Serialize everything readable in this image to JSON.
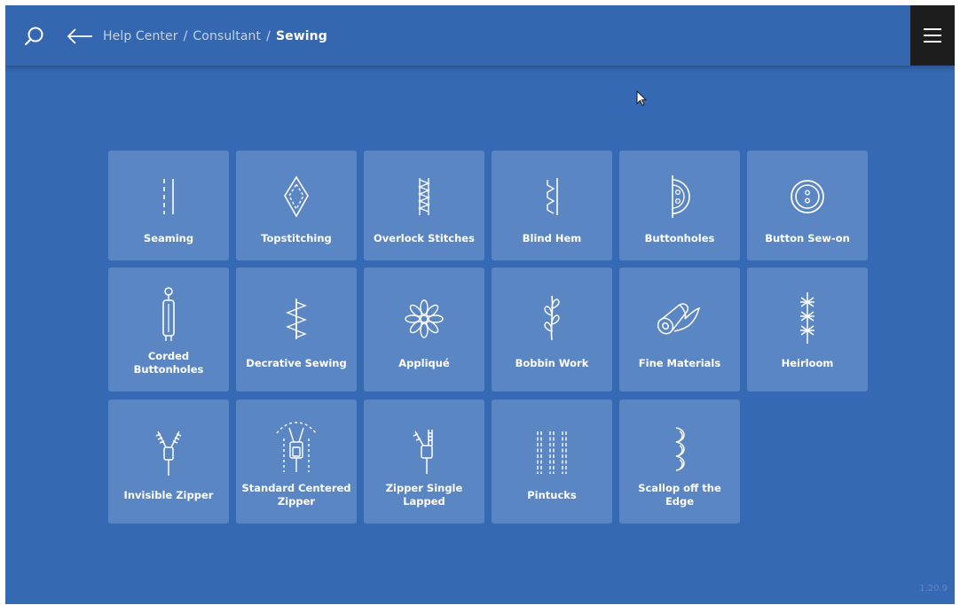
{
  "header": {
    "breadcrumb": {
      "help_center": "Help Center",
      "consultant": "Consultant",
      "current": "Sewing",
      "separator": "/"
    },
    "icons": {
      "search": "search-icon",
      "back": "arrow-left-icon",
      "menu": "hamburger-menu-icon"
    }
  },
  "tiles": [
    {
      "label": "Seaming",
      "icon": "seaming-icon"
    },
    {
      "label": "Topstitching",
      "icon": "topstitching-icon"
    },
    {
      "label": "Overlock Stitches",
      "icon": "overlock-stitch-icon"
    },
    {
      "label": "Blind Hem",
      "icon": "blind-hem-icon"
    },
    {
      "label": "Buttonholes",
      "icon": "buttonhole-icon"
    },
    {
      "label": "Button Sew-on",
      "icon": "button-icon"
    },
    {
      "label": "Corded Buttonholes",
      "icon": "corded-buttonhole-icon"
    },
    {
      "label": "Decrative Sewing",
      "icon": "decorative-stitch-icon"
    },
    {
      "label": "Appliqué",
      "icon": "applique-flower-icon"
    },
    {
      "label": "Bobbin Work",
      "icon": "bobbin-work-icon"
    },
    {
      "label": "Fine Materials",
      "icon": "fabric-roll-icon"
    },
    {
      "label": "Heirloom",
      "icon": "heirloom-stitch-icon"
    },
    {
      "label": "Invisible Zipper",
      "icon": "invisible-zipper-icon"
    },
    {
      "label": "Standard Centered Zipper",
      "icon": "centered-zipper-icon"
    },
    {
      "label": "Zipper Single Lapped",
      "icon": "lapped-zipper-icon"
    },
    {
      "label": "Pintucks",
      "icon": "pintucks-icon"
    },
    {
      "label": "Scallop off the Edge",
      "icon": "scallop-icon"
    }
  ],
  "footer": {
    "version": "1.20.9"
  },
  "colors": {
    "background": "#3669b3",
    "tile": "#5b86c4",
    "menu_button": "#1d1d1d"
  }
}
